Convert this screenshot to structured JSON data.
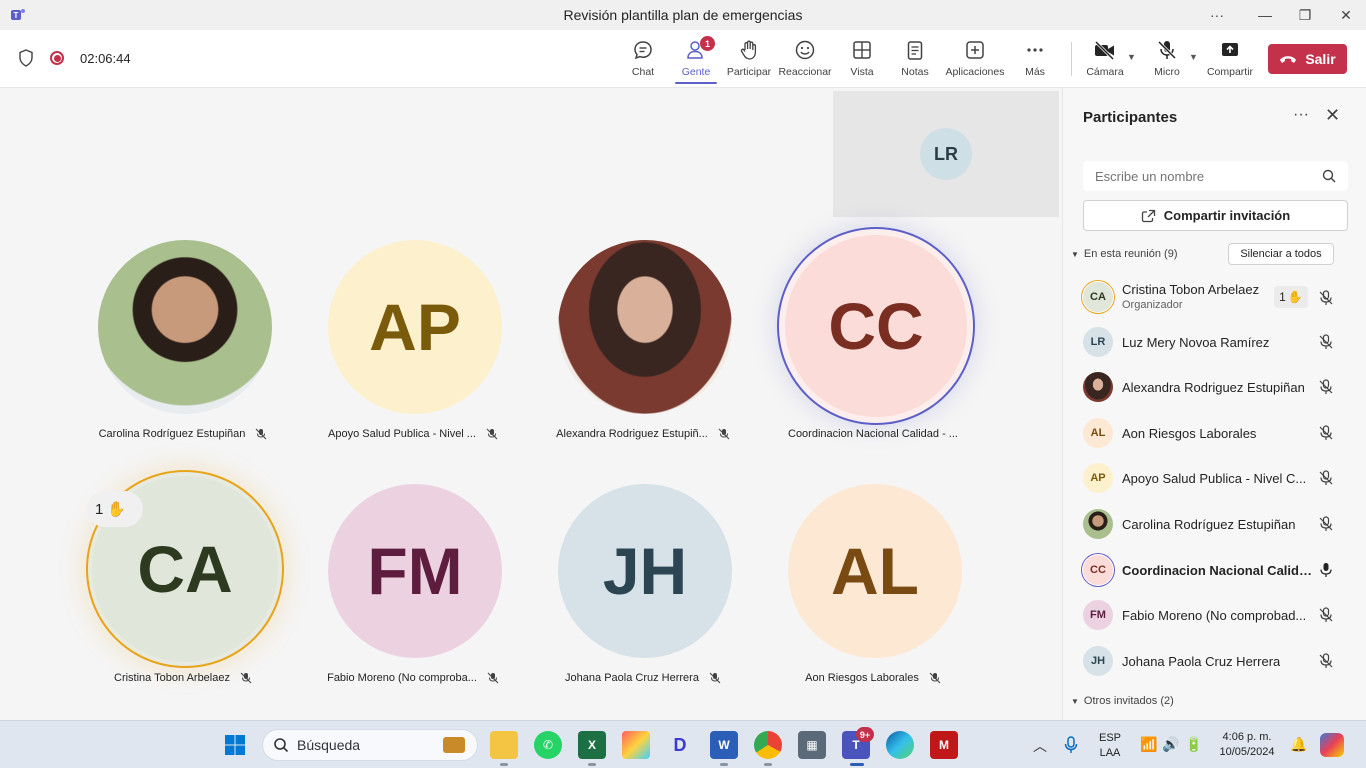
{
  "window": {
    "title": "Revisión plantilla plan de emergencias",
    "more": "···",
    "minimize": "—",
    "restore": "❐",
    "close": "✕"
  },
  "meeting": {
    "timer": "02:06:44",
    "toolbar": {
      "chat": "Chat",
      "people": "Gente",
      "people_badge": "1",
      "raise": "Participar",
      "react": "Reaccionar",
      "view": "Vista",
      "notes": "Notas",
      "apps": "Aplicaciones",
      "more": "Más",
      "camera": "Cámara",
      "mic": "Micro",
      "share": "Compartir",
      "leave": "Salir"
    }
  },
  "stage": {
    "self_view_initials": "LR",
    "hand_count": "1",
    "tiles": [
      {
        "name": "Carolina Rodríguez Estupiñan",
        "initials": "",
        "photo": true,
        "bg": "#8aa070",
        "fg": "#ffffff"
      },
      {
        "name": "Apoyo Salud Publica - Nivel ...",
        "initials": "AP",
        "photo": false,
        "bg": "#fdf0cc",
        "fg": "#7a5a0b"
      },
      {
        "name": "Alexandra Rodriguez Estupiñ...",
        "initials": "",
        "photo": true,
        "bg": "#5a3b2e",
        "fg": "#ffffff"
      },
      {
        "name": "Coordinacion Nacional Calidad - ...",
        "initials": "CC",
        "photo": false,
        "bg": "#fbdcd8",
        "fg": "#7a2e22"
      },
      {
        "name": "Cristina Tobon Arbelaez",
        "initials": "CA",
        "photo": false,
        "bg": "#e0e6da",
        "fg": "#2d3a1f"
      },
      {
        "name": "Fabio Moreno (No comproba...",
        "initials": "FM",
        "photo": false,
        "bg": "#ecd2e0",
        "fg": "#5e1d3f"
      },
      {
        "name": "Johana Paola Cruz Herrera",
        "initials": "JH",
        "photo": false,
        "bg": "#d6e2e8",
        "fg": "#2b4552"
      },
      {
        "name": "Aon Riesgos Laborales",
        "initials": "AL",
        "photo": false,
        "bg": "#fde8d4",
        "fg": "#7a4a13"
      }
    ]
  },
  "panel": {
    "title": "Participantes",
    "more": "···",
    "close": "✕",
    "search_placeholder": "Escribe un nombre",
    "share_invite": "Compartir invitación",
    "in_meeting": "En esta reunión (9)",
    "mute_all": "Silenciar a todos",
    "others": "Otros invitados (2)",
    "hand_count": "1",
    "participants": [
      {
        "initials": "CA",
        "name": "Cristina Tobon Arbelaez",
        "role": "Organizador",
        "bg": "#e0e6da",
        "fg": "#2d3a1f",
        "photo": false,
        "muted": true
      },
      {
        "initials": "LR",
        "name": "Luz Mery Novoa Ramírez",
        "role": "",
        "bg": "#d6e2e8",
        "fg": "#2b4552",
        "photo": false,
        "muted": true
      },
      {
        "initials": "",
        "name": "Alexandra Rodriguez Estupiñan",
        "role": "",
        "bg": "#7a4b35",
        "fg": "#ffffff",
        "photo": true,
        "muted": true
      },
      {
        "initials": "AL",
        "name": "Aon Riesgos Laborales",
        "role": "",
        "bg": "#fde8d4",
        "fg": "#7a4a13",
        "photo": false,
        "muted": true
      },
      {
        "initials": "AP",
        "name": "Apoyo Salud Publica - Nivel C...",
        "role": "",
        "bg": "#fdf0cc",
        "fg": "#7a5a0b",
        "photo": false,
        "muted": true
      },
      {
        "initials": "",
        "name": "Carolina Rodríguez Estupiñan",
        "role": "",
        "bg": "#8aa070",
        "fg": "#ffffff",
        "photo": true,
        "muted": true
      },
      {
        "initials": "CC",
        "name": "Coordinacion Nacional Calida...",
        "role": "",
        "bg": "#fbdcd8",
        "fg": "#7a2e22",
        "photo": false,
        "muted": false
      },
      {
        "initials": "FM",
        "name": "Fabio Moreno (No comprobad...",
        "role": "",
        "bg": "#ecd2e0",
        "fg": "#5e1d3f",
        "photo": false,
        "muted": true
      },
      {
        "initials": "JH",
        "name": "Johana Paola Cruz Herrera",
        "role": "",
        "bg": "#d6e2e8",
        "fg": "#2b4552",
        "photo": false,
        "muted": true
      }
    ]
  },
  "taskbar": {
    "search_label": "Búsqueda",
    "lang": "ESP",
    "layout": "LAA",
    "time": "4:06 p. m.",
    "date": "10/05/2024",
    "teams_badge": "9+"
  }
}
